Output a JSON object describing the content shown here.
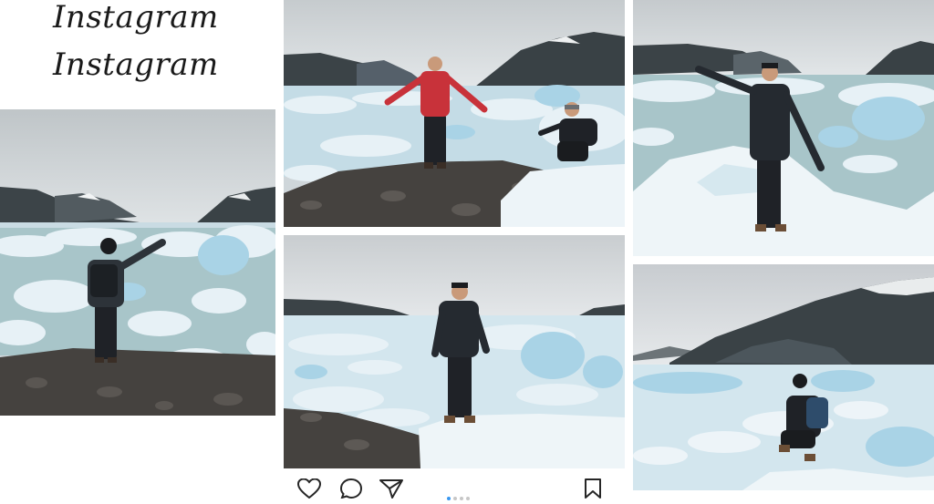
{
  "logo": {
    "line1": "Instagram",
    "line2": "Instagram"
  },
  "photos": [
    {
      "id": "left-glacier-photo",
      "scene": "person with backpack pointing toward glacier, standing on rocky shore"
    },
    {
      "id": "top-center-glacier-photo",
      "scene": "person in red jacket with arms raised on rocks, another person crouching on ice"
    },
    {
      "id": "middle-center-glacier-photo",
      "scene": "person in black jacket standing on ice floe"
    },
    {
      "id": "top-right-glacier-photo",
      "scene": "person in black jacket with arm raised on ice"
    },
    {
      "id": "bottom-right-glacier-photo",
      "scene": "person with backpack crouching on ice facing mountains"
    }
  ],
  "icons": {
    "like": "heart-icon",
    "comment": "comment-icon",
    "share": "share-icon",
    "save": "bookmark-icon"
  },
  "carousel": {
    "count": 4,
    "active": 1
  },
  "colors": {
    "sky": "#d9dee1",
    "ice": "#e7f1f6",
    "ice_blue": "#a9d3e6",
    "water": "#a8c5c9",
    "mountain": "#3c4448",
    "rock": "#45423f",
    "jacket_red": "#c8323a",
    "jacket_black": "#1f2227",
    "carousel_active": "#3897f0"
  }
}
